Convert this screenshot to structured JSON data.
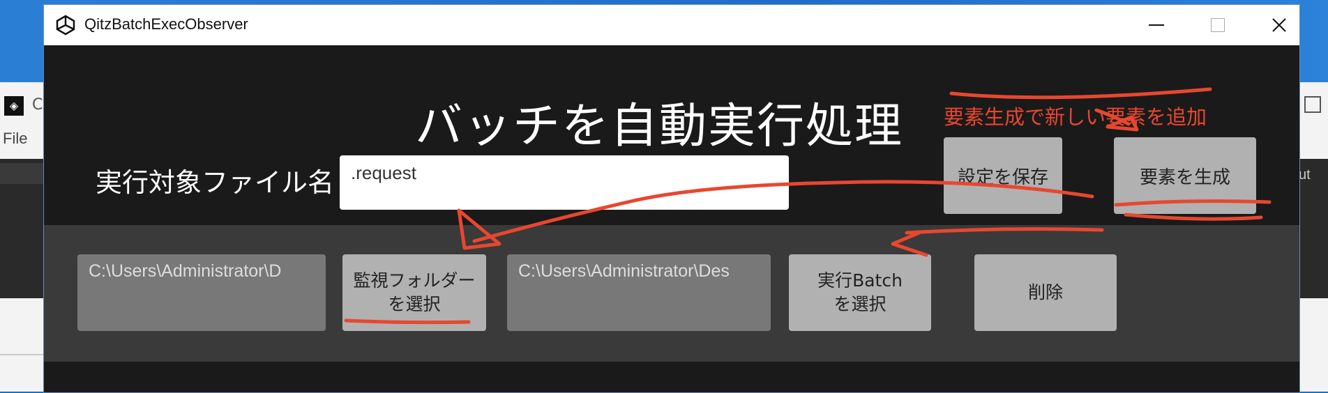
{
  "background": {
    "left_letter": "C",
    "file_menu": "File",
    "right_text": "ut"
  },
  "window": {
    "title": "QitzBatchExecObserver",
    "controls": {
      "minimize": "—",
      "maximize": "□",
      "close": "✕"
    }
  },
  "main": {
    "heading": "バッチを自動実行処理",
    "file_name_label": "実行対象ファイル名",
    "file_name_value": ".request",
    "save_button": "設定を保存",
    "generate_button": "要素を生成"
  },
  "row": {
    "watch_folder_path": "C:\\Users\\Administrator\\D",
    "watch_folder_button_line1": "監視フォルダー",
    "watch_folder_button_line2": "を選択",
    "batch_path": "C:\\Users\\Administrator\\Des",
    "batch_button_line1": "実行Batch",
    "batch_button_line2": "を選択",
    "delete_button": "削除"
  },
  "annotation": {
    "text": "要素生成で新しい要素を追加",
    "color": "#e8472f"
  },
  "colors": {
    "window_bg": "#1a1a1a",
    "band_bg": "#3a3a3a",
    "button_bg": "#b1b1b1",
    "path_bg": "#787878"
  }
}
